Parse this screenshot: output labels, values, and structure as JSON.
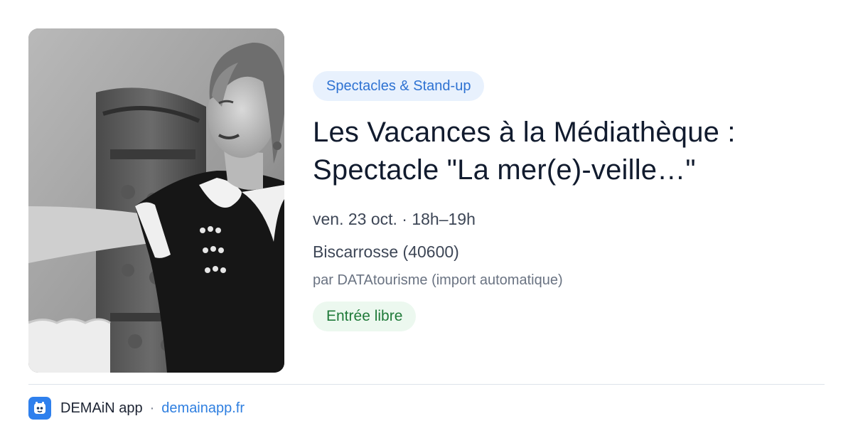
{
  "event": {
    "photo_alt": "Photo of the performer",
    "category": "Spectacles & Stand-up",
    "title_line1": "Les Vacances à la Médiathèque :",
    "title_line2": "Spectacle \"La mer(e)-veille…\"",
    "date": "ven. 23 oct. · 18h–19h",
    "location": "Biscarrosse (40600)",
    "source": "par DATAtourisme (import automatique)",
    "price": "Entrée libre"
  },
  "footer": {
    "app_name": "DEMAiN app",
    "separator": "·",
    "site": "demainapp.fr",
    "logo_icon": "demain-app-logo-icon"
  },
  "colors": {
    "accent": "#2f80ed",
    "category_bg": "#e8f1fd",
    "price_bg": "#ecf8ef",
    "price_text": "#1f7a39"
  }
}
